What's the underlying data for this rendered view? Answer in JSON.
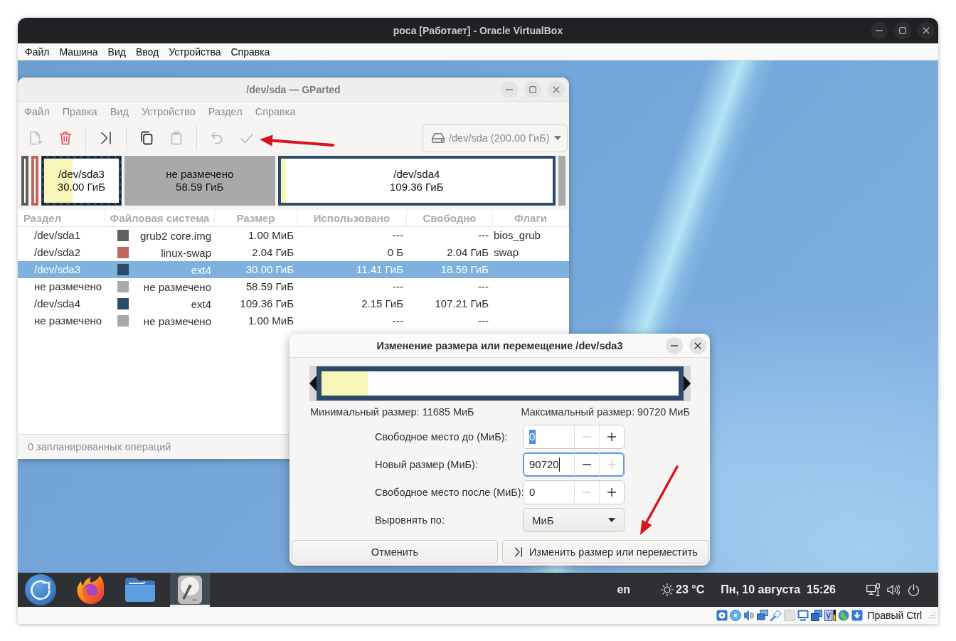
{
  "vbox": {
    "title": "роса [Работает] - Oracle VirtualBox",
    "menu": [
      "Файл",
      "Машина",
      "Вид",
      "Ввод",
      "Устройства",
      "Справка"
    ]
  },
  "gparted": {
    "title": "/dev/sda — GParted",
    "menu": [
      "Файл",
      "Правка",
      "Вид",
      "Устройство",
      "Раздел",
      "Справка"
    ],
    "toolbar": [
      [
        {
          "kind": "new",
          "disabled": true
        },
        {
          "kind": "delete",
          "disabled": false
        }
      ],
      [
        {
          "kind": "resize",
          "disabled": false
        }
      ],
      [
        {
          "kind": "copy",
          "disabled": false
        },
        {
          "kind": "paste",
          "disabled": true
        }
      ],
      [
        {
          "kind": "undo",
          "disabled": true
        },
        {
          "kind": "apply",
          "disabled": true
        }
      ]
    ],
    "device": "/dev/sda (200.00 ГиБ)",
    "partition_map": [
      {
        "kind": "partition",
        "color": "#5e5e5e",
        "selected": false
      },
      {
        "kind": "partition",
        "color": "#c1665a",
        "selected": false
      },
      {
        "kind": "partition",
        "color": "#2e4a6b",
        "selected": true,
        "level": 0.38,
        "name": "/dev/sda3",
        "size": "30.00 ГиБ"
      },
      {
        "kind": "unallocated",
        "color": "#a9a9a9",
        "selected": false,
        "name": "не размечено",
        "size": "58.59 ГиБ"
      },
      {
        "kind": "partition",
        "color": "#2e4a6b",
        "selected": false,
        "level": 0.02,
        "name": "/dev/sda4",
        "size": "109.36 ГиБ"
      },
      {
        "kind": "unallocated",
        "color": "#a9a9a9",
        "selected": false
      }
    ],
    "table": {
      "columns": [
        "Раздел",
        "Файловая система",
        "Размер",
        "Использовано",
        "Свободно",
        "Флаги"
      ],
      "rows": [
        {
          "partition": "/dev/sda1",
          "color": "#616161",
          "filesystem": "grub2 core.img",
          "size": "1.00 МиБ",
          "used": "---",
          "free": "---",
          "flags": "bios_grub",
          "selected": false
        },
        {
          "partition": "/dev/sda2",
          "color": "#c1665a",
          "filesystem": "linux-swap",
          "size": "2.04 ГиБ",
          "used": "0 Б",
          "free": "2.04 ГиБ",
          "flags": "swap",
          "selected": false
        },
        {
          "partition": "/dev/sda3",
          "color": "#2e4a6b",
          "filesystem": "ext4",
          "size": "30.00 ГиБ",
          "used": "11.41 ГиБ",
          "free": "18.59 ГиБ",
          "selected": true
        },
        {
          "partition": "не размечено",
          "color": "#a9a9a9",
          "filesystem": "не размечено",
          "size": "58.59 ГиБ",
          "used": "---",
          "free": "---",
          "selected": false
        },
        {
          "partition": "/dev/sda4",
          "color": "#2e4a6b",
          "filesystem": "ext4",
          "size": "109.36 ГиБ",
          "used": "2.15 ГиБ",
          "free": "107.21 ГиБ",
          "selected": false
        },
        {
          "partition": "не размечено",
          "color": "#a9a9a9",
          "filesystem": "не размечено",
          "size": "1.00 МиБ",
          "used": "---",
          "free": "---",
          "selected": false
        }
      ]
    },
    "status": "0 запланированных операций"
  },
  "dialog": {
    "title": "Изменение размера или перемещение /dev/sda3",
    "resizer": {
      "level": 0.13
    },
    "min_size": "Минимальный размер: 11685 МиБ",
    "max_size": "Максимальный размер: 90720 МиБ",
    "fields": [
      {
        "kind": "spin",
        "label": "Свободное место до (МиБ):",
        "value": "0",
        "text_selected": true,
        "focused": false,
        "minus_disabled": true,
        "plus_disabled": false
      },
      {
        "kind": "spin",
        "label": "Новый размер (МиБ):",
        "value": "90720",
        "text_selected": false,
        "focused": true,
        "minus_disabled": false,
        "plus_disabled": true
      },
      {
        "kind": "spin",
        "label": "Свободное место после (МиБ):",
        "value": "0",
        "text_selected": false,
        "focused": false,
        "minus_disabled": true,
        "plus_disabled": false
      },
      {
        "kind": "combo",
        "label": "Выровнять по:",
        "value": "МиБ"
      }
    ],
    "buttons": [
      {
        "kind": "cancel",
        "label": "Отменить"
      },
      {
        "kind": "resize",
        "label": "Изменить размер или переместить"
      }
    ]
  },
  "taskbar": {
    "apps": [
      {
        "kind": "launcher",
        "selected": false
      },
      {
        "kind": "browser",
        "selected": false
      },
      {
        "kind": "files",
        "selected": false
      },
      {
        "kind": "disk",
        "selected": true
      }
    ],
    "layout": "en",
    "weather": "23 °C",
    "date": "Пн, 10 августа",
    "time": "15:26"
  },
  "vbox_status": {
    "host_key": "Правый Ctrl"
  }
}
